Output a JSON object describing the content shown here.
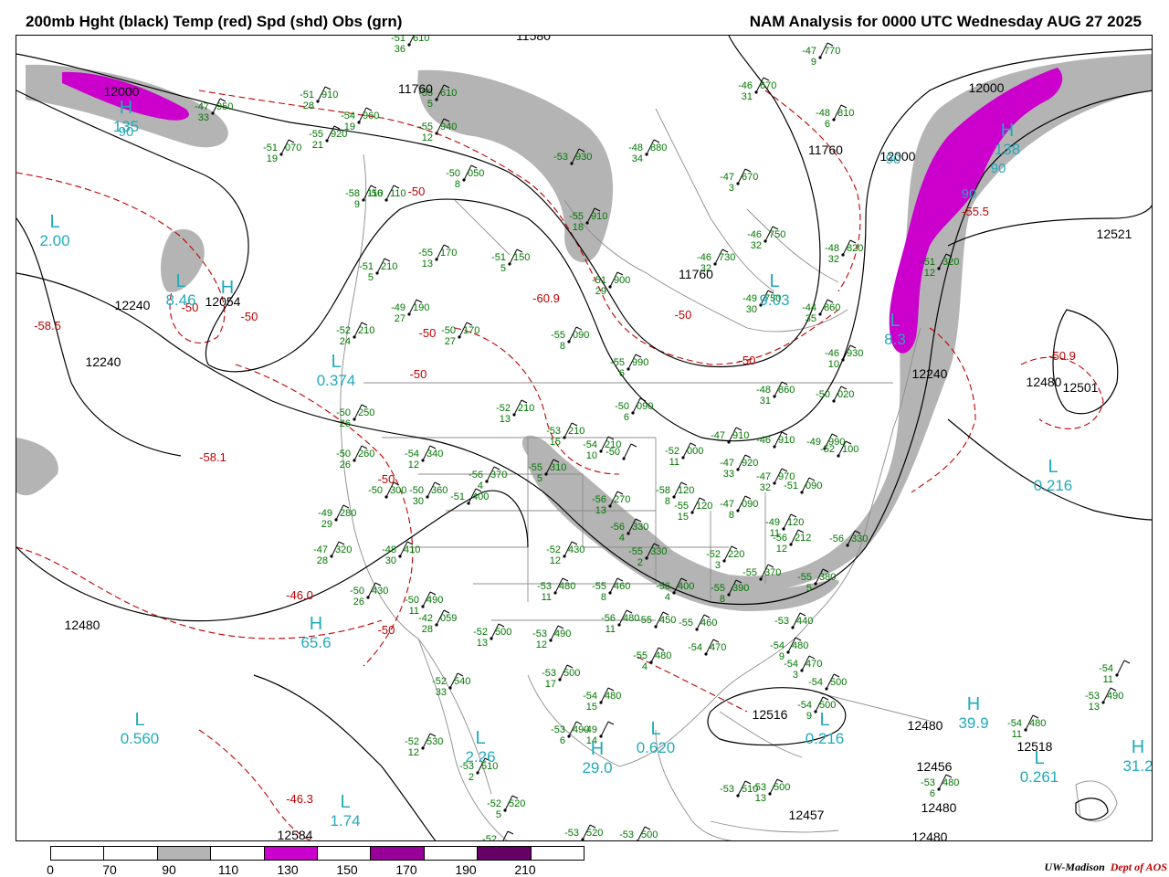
{
  "header": {
    "left_title": "200mb Hght (black) Temp (red) Spd (shd) Obs (grn)",
    "right_title": "NAM Analysis for 0000 UTC Wednesday  AUG 27 2025"
  },
  "colors": {
    "height_contour": "#000000",
    "temp_contour": "#c00000",
    "obs": "#007700",
    "center_label": "#22aabb",
    "speed_70_90": "#b4b4b4",
    "speed_110_130": "#cc00cc",
    "speed_150_170": "#990099",
    "speed_190_210": "#660066",
    "geography": "#8c8c8c",
    "credit_red": "#c00000"
  },
  "colorbar": {
    "labels": [
      "0",
      "70",
      "90",
      "110",
      "130",
      "150",
      "170",
      "190",
      "210"
    ],
    "segments": [
      "#ffffff",
      "#ffffff",
      "#b4b4b4",
      "#ffffff",
      "#cc00cc",
      "#ffffff",
      "#990099",
      "#ffffff",
      "#660066",
      "#ffffff"
    ]
  },
  "height_labels": [
    "11580",
    "12000",
    "11760",
    "11760",
    "11760",
    "12000",
    "12000",
    "12240",
    "12240",
    "12054",
    "12240",
    "12480",
    "12480",
    "12521",
    "12501",
    "12480",
    "12516",
    "12480",
    "12456",
    "12457",
    "12518",
    "12480",
    "12584"
  ],
  "temp_labels": [
    "-58.5",
    "-50",
    "-50",
    "-50",
    "-60.9",
    "-58.1",
    "-50",
    "-50",
    "-50",
    "-50",
    "-50",
    "-55.5",
    "-50.9",
    "-46.3",
    "-46.0",
    "-50"
  ],
  "centers": [
    {
      "letter": "H",
      "value": "135"
    },
    {
      "letter": "H",
      "value": "138"
    },
    {
      "letter": "L",
      "value": "2.00"
    },
    {
      "letter": "L",
      "value": "8.46"
    },
    {
      "letter": "H",
      "value": ""
    },
    {
      "letter": "L",
      "value": "9.03"
    },
    {
      "letter": "L",
      "value": "0.374"
    },
    {
      "letter": "L",
      "value": "0.216"
    },
    {
      "letter": "L",
      "value": "0.560"
    },
    {
      "letter": "H",
      "value": "65.6"
    },
    {
      "letter": "L",
      "value": "2.26"
    },
    {
      "letter": "H",
      "value": "29.0"
    },
    {
      "letter": "L",
      "value": "0.620"
    },
    {
      "letter": "L",
      "value": "0.216"
    },
    {
      "letter": "H",
      "value": "39.9"
    },
    {
      "letter": "L",
      "value": "0.261"
    },
    {
      "letter": "H",
      "value": "31.2"
    },
    {
      "letter": "L",
      "value": "1.74"
    },
    {
      "letter": "L",
      "value": "8.3"
    }
  ],
  "speed_labels": [
    "90",
    "90",
    "90",
    "90"
  ],
  "obs": [
    {
      "temp": "-51",
      "hgt": "610",
      "dew": "36"
    },
    {
      "temp": "-47",
      "hgt": "770",
      "dew": "9"
    },
    {
      "temp": "-47",
      "hgt": "950",
      "dew": "33"
    },
    {
      "temp": "-51",
      "hgt": "910",
      "dew": "28"
    },
    {
      "temp": "-54",
      "hgt": "960",
      "dew": "19"
    },
    {
      "temp": "-55",
      "hgt": "920",
      "dew": "21"
    },
    {
      "temp": "-51",
      "hgt": "070",
      "dew": "19"
    },
    {
      "temp": "-55",
      "hgt": "610",
      "dew": "5"
    },
    {
      "temp": "-46",
      "hgt": "670",
      "dew": "31"
    },
    {
      "temp": "-48",
      "hgt": "810",
      "dew": "6"
    },
    {
      "temp": "-55",
      "hgt": "940",
      "dew": "12"
    },
    {
      "temp": "-48",
      "hgt": "880",
      "dew": "34"
    },
    {
      "temp": "-53",
      "hgt": "930",
      "dew": ""
    },
    {
      "temp": "-50",
      "hgt": "050",
      "dew": "8"
    },
    {
      "temp": "-47",
      "hgt": "670",
      "dew": "3"
    },
    {
      "temp": "-58",
      "hgt": "110",
      "dew": "9"
    },
    {
      "temp": "-56",
      "hgt": "110",
      "dew": ""
    },
    {
      "temp": "-55",
      "hgt": "910",
      "dew": "18"
    },
    {
      "temp": "-46",
      "hgt": "750",
      "dew": "32"
    },
    {
      "temp": "-48",
      "hgt": "820",
      "dew": "32"
    },
    {
      "temp": "-55",
      "hgt": "170",
      "dew": "13"
    },
    {
      "temp": "-51",
      "hgt": "150",
      "dew": "5"
    },
    {
      "temp": "-51",
      "hgt": "210",
      "dew": "5"
    },
    {
      "temp": "-51",
      "hgt": "900",
      "dew": "29"
    },
    {
      "temp": "-46",
      "hgt": "730",
      "dew": "32"
    },
    {
      "temp": "-49",
      "hgt": "750",
      "dew": "30"
    },
    {
      "temp": "-44",
      "hgt": "860",
      "dew": "35"
    },
    {
      "temp": "-51",
      "hgt": "320",
      "dew": "12"
    },
    {
      "temp": "-49",
      "hgt": "190",
      "dew": "27"
    },
    {
      "temp": "-50",
      "hgt": "170",
      "dew": "27"
    },
    {
      "temp": "-52",
      "hgt": "210",
      "dew": "24"
    },
    {
      "temp": "-55",
      "hgt": "090",
      "dew": "8"
    },
    {
      "temp": "-46",
      "hgt": "930",
      "dew": "10"
    },
    {
      "temp": "-55",
      "hgt": "990",
      "dew": "6"
    },
    {
      "temp": "-48",
      "hgt": "860",
      "dew": "31"
    },
    {
      "temp": "-50",
      "hgt": "020",
      "dew": ""
    },
    {
      "temp": "-52",
      "hgt": "210",
      "dew": "13"
    },
    {
      "temp": "-50",
      "hgt": "090",
      "dew": "6"
    },
    {
      "temp": "-50",
      "hgt": "250",
      "dew": "26"
    },
    {
      "temp": "-53",
      "hgt": "210",
      "dew": "15"
    },
    {
      "temp": "-54",
      "hgt": "210",
      "dew": "10"
    },
    {
      "temp": "-50",
      "hgt": "",
      "dew": ""
    },
    {
      "temp": "-52",
      "hgt": "000",
      "dew": "11"
    },
    {
      "temp": "-47",
      "hgt": "910",
      "dew": ""
    },
    {
      "temp": "-46",
      "hgt": "910",
      "dew": ""
    },
    {
      "temp": "-49",
      "hgt": "990",
      "dew": ""
    },
    {
      "temp": "-52",
      "hgt": "100",
      "dew": ""
    },
    {
      "temp": "-50",
      "hgt": "260",
      "dew": "26"
    },
    {
      "temp": "-54",
      "hgt": "340",
      "dew": "12"
    },
    {
      "temp": "-56",
      "hgt": "370",
      "dew": "4"
    },
    {
      "temp": "-55",
      "hgt": "310",
      "dew": "5"
    },
    {
      "temp": "-47",
      "hgt": "920",
      "dew": "33"
    },
    {
      "temp": "-47",
      "hgt": "970",
      "dew": "32"
    },
    {
      "temp": "-51",
      "hgt": "090",
      "dew": ""
    },
    {
      "temp": "-50",
      "hgt": "300",
      "dew": ""
    },
    {
      "temp": "-50",
      "hgt": "360",
      "dew": "30"
    },
    {
      "temp": "-51",
      "hgt": "400",
      "dew": ""
    },
    {
      "temp": "-56",
      "hgt": "270",
      "dew": "13"
    },
    {
      "temp": "-58",
      "hgt": "120",
      "dew": "8"
    },
    {
      "temp": "-55",
      "hgt": "120",
      "dew": "15"
    },
    {
      "temp": "-47",
      "hgt": "090",
      "dew": "8"
    },
    {
      "temp": "-49",
      "hgt": "120",
      "dew": "11"
    },
    {
      "temp": "-49",
      "hgt": "280",
      "dew": "29"
    },
    {
      "temp": "-56",
      "hgt": "330",
      "dew": "4"
    },
    {
      "temp": "-56",
      "hgt": "212",
      "dew": "12"
    },
    {
      "temp": "-56",
      "hgt": "330",
      "dew": ""
    },
    {
      "temp": "-47",
      "hgt": "320",
      "dew": "28"
    },
    {
      "temp": "-48",
      "hgt": "410",
      "dew": "30"
    },
    {
      "temp": "-52",
      "hgt": "430",
      "dew": "12"
    },
    {
      "temp": "-55",
      "hgt": "330",
      "dew": "2"
    },
    {
      "temp": "-52",
      "hgt": "220",
      "dew": "3"
    },
    {
      "temp": "-55",
      "hgt": "370",
      "dew": ""
    },
    {
      "temp": "-55",
      "hgt": "380",
      "dew": "5"
    },
    {
      "temp": "-50",
      "hgt": "430",
      "dew": "26"
    },
    {
      "temp": "-50",
      "hgt": "490",
      "dew": "11"
    },
    {
      "temp": "-53",
      "hgt": "480",
      "dew": "11"
    },
    {
      "temp": "-55",
      "hgt": "460",
      "dew": "8"
    },
    {
      "temp": "-56",
      "hgt": "400",
      "dew": "4"
    },
    {
      "temp": "-55",
      "hgt": "390",
      "dew": "8"
    },
    {
      "temp": "-42",
      "hgt": "059",
      "dew": "28"
    },
    {
      "temp": "-52",
      "hgt": "500",
      "dew": "13"
    },
    {
      "temp": "-53",
      "hgt": "490",
      "dew": "12"
    },
    {
      "temp": "-56",
      "hgt": "480",
      "dew": "11"
    },
    {
      "temp": "-55",
      "hgt": "450",
      "dew": ""
    },
    {
      "temp": "-55",
      "hgt": "460",
      "dew": ""
    },
    {
      "temp": "-53",
      "hgt": "440",
      "dew": ""
    },
    {
      "temp": "-54",
      "hgt": "480",
      "dew": "9"
    },
    {
      "temp": "-55",
      "hgt": "480",
      "dew": "4"
    },
    {
      "temp": "-54",
      "hgt": "470",
      "dew": ""
    },
    {
      "temp": "-54",
      "hgt": "470",
      "dew": "3"
    },
    {
      "temp": "-52",
      "hgt": "540",
      "dew": "33"
    },
    {
      "temp": "-53",
      "hgt": "500",
      "dew": "17"
    },
    {
      "temp": "-54",
      "hgt": "480",
      "dew": "15"
    },
    {
      "temp": "-54",
      "hgt": "500",
      "dew": ""
    },
    {
      "temp": "-54",
      "hgt": "500",
      "dew": "9"
    },
    {
      "temp": "-53",
      "hgt": "490",
      "dew": "6"
    },
    {
      "temp": "-49",
      "hgt": "",
      "dew": "14"
    },
    {
      "temp": "-52",
      "hgt": "530",
      "dew": "12"
    },
    {
      "temp": "-53",
      "hgt": "510",
      "dew": "2"
    },
    {
      "temp": "-52",
      "hgt": "520",
      "dew": "5"
    },
    {
      "temp": "-53",
      "hgt": "510",
      "dew": ""
    },
    {
      "temp": "-53",
      "hgt": "500",
      "dew": "13"
    },
    {
      "temp": "-53",
      "hgt": "480",
      "dew": "6"
    },
    {
      "temp": "-54",
      "hgt": "480",
      "dew": "11"
    },
    {
      "temp": "-53",
      "hgt": "490",
      "dew": "13"
    },
    {
      "temp": "-54",
      "hgt": "",
      "dew": "11"
    },
    {
      "temp": "-53",
      "hgt": "520",
      "dew": ""
    },
    {
      "temp": "-53",
      "hgt": "500",
      "dew": ""
    },
    {
      "temp": "-52",
      "hgt": "",
      "dew": ""
    }
  ],
  "credit": {
    "part1": "UW-Madison",
    "part2": "Dept of AOS"
  }
}
